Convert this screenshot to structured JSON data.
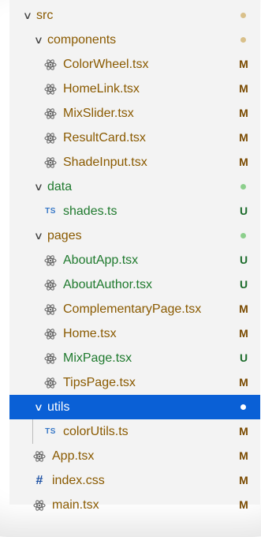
{
  "colors": {
    "modified": "#8a5a00",
    "untracked": "#1f7a2e",
    "modified_status": "#7a4a00",
    "untracked_status": "#1b6b2a",
    "dot_folder_modified": "#d9c08a",
    "dot_folder_untracked": "#8ccf8c",
    "selection": "#0a60d6"
  },
  "tree": {
    "src": {
      "label": "src"
    },
    "components": {
      "label": "components"
    },
    "colorwheel": {
      "label": "ColorWheel.tsx",
      "status": "M"
    },
    "homelink": {
      "label": "HomeLink.tsx",
      "status": "M"
    },
    "mixslider": {
      "label": "MixSlider.tsx",
      "status": "M"
    },
    "resultcard": {
      "label": "ResultCard.tsx",
      "status": "M"
    },
    "shadeinput": {
      "label": "ShadeInput.tsx",
      "status": "M"
    },
    "data": {
      "label": "data"
    },
    "shades": {
      "label": "shades.ts",
      "status": "U",
      "badge": "TS"
    },
    "pages": {
      "label": "pages"
    },
    "aboutapp": {
      "label": "AboutApp.tsx",
      "status": "U"
    },
    "aboutauthor": {
      "label": "AboutAuthor.tsx",
      "status": "U"
    },
    "complementary": {
      "label": "ComplementaryPage.tsx",
      "status": "M"
    },
    "home": {
      "label": "Home.tsx",
      "status": "M"
    },
    "mixpage": {
      "label": "MixPage.tsx",
      "status": "U"
    },
    "tipspage": {
      "label": "TipsPage.tsx",
      "status": "M"
    },
    "utils": {
      "label": "utils"
    },
    "colorutils": {
      "label": "colorUtils.ts",
      "status": "M",
      "badge": "TS"
    },
    "app": {
      "label": "App.tsx",
      "status": "M"
    },
    "indexcss": {
      "label": "index.css",
      "status": "M",
      "badge": "#"
    },
    "main": {
      "label": "main.tsx",
      "status": "M"
    }
  }
}
